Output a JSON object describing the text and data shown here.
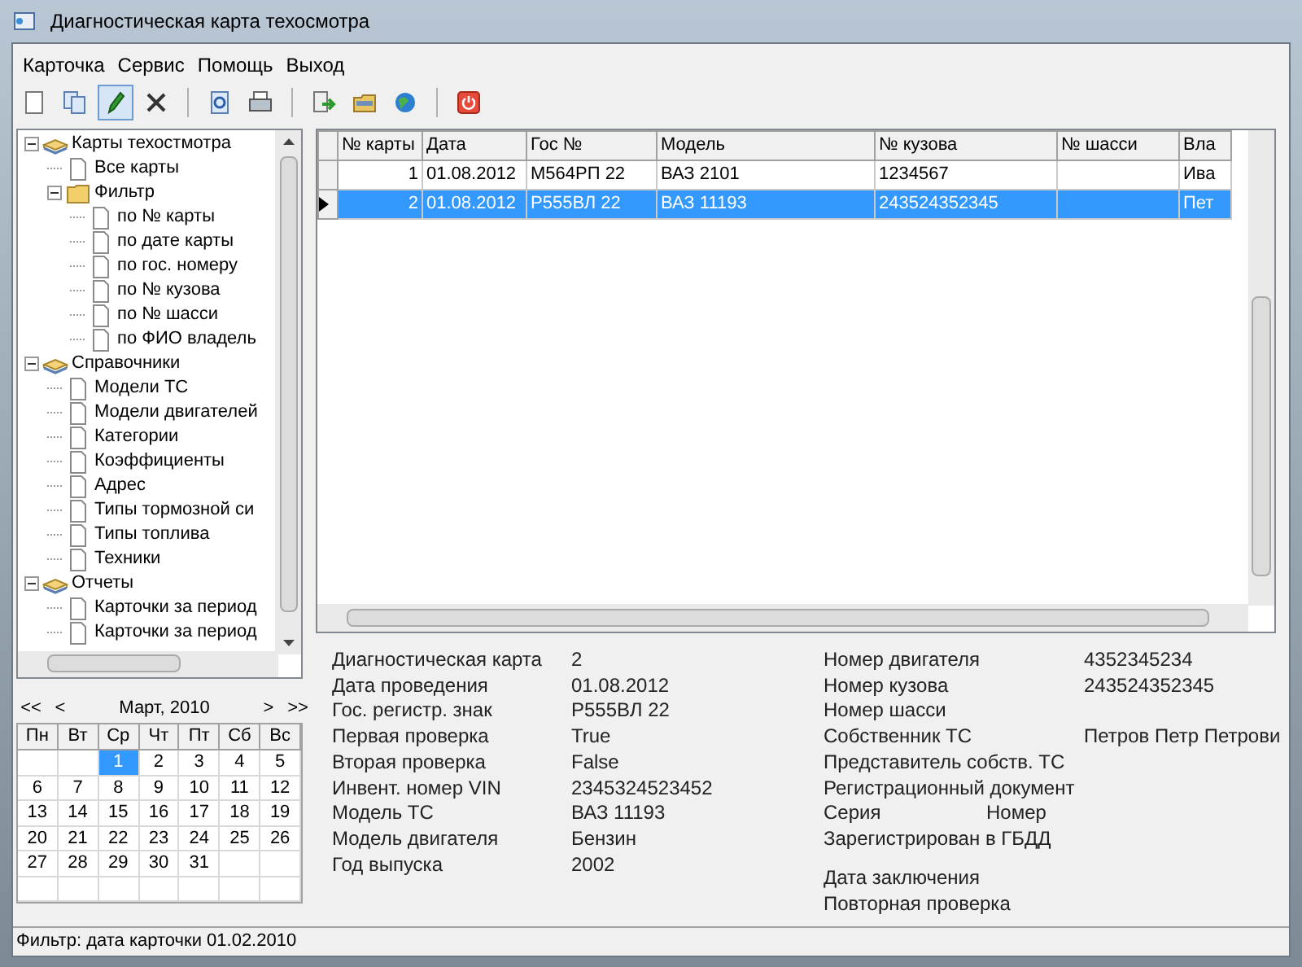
{
  "window": {
    "title": "Диагностическая карта техосмотра"
  },
  "menu": [
    "Карточка",
    "Сервис",
    "Помощь",
    "Выход"
  ],
  "toolbar": [
    {
      "kind": "new",
      "pressed": false
    },
    {
      "kind": "copy",
      "pressed": false
    },
    {
      "kind": "edit",
      "pressed": true
    },
    {
      "kind": "delete",
      "pressed": false
    },
    {
      "kind": "sep"
    },
    {
      "kind": "preview",
      "pressed": false
    },
    {
      "kind": "print",
      "pressed": false
    },
    {
      "kind": "sep"
    },
    {
      "kind": "export",
      "pressed": false
    },
    {
      "kind": "folder",
      "pressed": false
    },
    {
      "kind": "globe",
      "pressed": false
    },
    {
      "kind": "sep"
    },
    {
      "kind": "power",
      "pressed": false
    }
  ],
  "tree": [
    {
      "label": "Карты техостмотра",
      "kind": "books",
      "expanded": true,
      "children": [
        {
          "label": "Все карты",
          "kind": "doc"
        },
        {
          "label": "Фильтр",
          "kind": "folder",
          "expanded": true,
          "children": [
            {
              "label": "по № карты",
              "kind": "doc"
            },
            {
              "label": "по дате карты",
              "kind": "doc"
            },
            {
              "label": "по гос. номеру",
              "kind": "doc"
            },
            {
              "label": "по № кузова",
              "kind": "doc"
            },
            {
              "label": "по № шасси",
              "kind": "doc"
            },
            {
              "label": "по ФИО владель",
              "kind": "doc"
            }
          ]
        }
      ]
    },
    {
      "label": "Справочники",
      "kind": "books",
      "expanded": true,
      "children": [
        {
          "label": "Модели ТС",
          "kind": "doc"
        },
        {
          "label": "Модели двигателей",
          "kind": "doc"
        },
        {
          "label": "Категории",
          "kind": "doc"
        },
        {
          "label": "Коэффициенты",
          "kind": "doc"
        },
        {
          "label": "Адрес",
          "kind": "doc"
        },
        {
          "label": "Типы тормозной си",
          "kind": "doc"
        },
        {
          "label": "Типы топлива",
          "kind": "doc"
        },
        {
          "label": "Техники",
          "kind": "doc"
        }
      ]
    },
    {
      "label": "Отчеты",
      "kind": "books",
      "expanded": true,
      "children": [
        {
          "label": "Карточки за период",
          "kind": "doc"
        },
        {
          "label": "Карточки за период",
          "kind": "doc"
        }
      ]
    }
  ],
  "table": {
    "columns": [
      "№ карты",
      "Дата",
      "Гос №",
      "Модель",
      "№ кузова",
      "№ шасси",
      "Вла"
    ],
    "rows": [
      {
        "selected": false,
        "cells": [
          "1",
          "01.08.2012",
          "М564РП 22",
          "ВАЗ 2101",
          "1234567",
          "",
          "Ива"
        ]
      },
      {
        "selected": true,
        "cells": [
          "2",
          "01.08.2012",
          "Р555ВЛ 22",
          "ВАЗ 11193",
          "243524352345",
          "",
          "Пет"
        ]
      }
    ]
  },
  "details_left": [
    {
      "label": "Диагностическая карта",
      "value": "2"
    },
    {
      "label": "Дата проведения",
      "value": "01.08.2012"
    },
    {
      "label": "Гос. регистр. знак",
      "value": "Р555ВЛ 22"
    },
    {
      "label": "Первая проверка",
      "value": "True"
    },
    {
      "label": "Вторая проверка",
      "value": "False"
    },
    {
      "label": "Инвент. номер VIN",
      "value": "2345324523452"
    },
    {
      "label": "Модель ТС",
      "value": "ВАЗ 11193"
    },
    {
      "label": "Модель двигателя",
      "value": "Бензин"
    },
    {
      "label": "Год выпуска",
      "value": "2002"
    }
  ],
  "details_right": [
    {
      "label": "Номер двигателя",
      "value": "4352345234"
    },
    {
      "label": "Номер кузова",
      "value": "243524352345"
    },
    {
      "label": "Номер шасси"
    },
    {
      "label": "Собственник ТС",
      "value": "Петров Петр Петрови"
    },
    {
      "label": "Представитель собств. ТС"
    },
    {
      "label": "Регистрационный документ"
    },
    {
      "label": "Серия",
      "label_2": "Номер"
    },
    {
      "label": "Зарегистрирован в ГБДД"
    }
  ],
  "details_right_bottom": [
    {
      "label": "Дата заключения"
    },
    {
      "label": "Повторная проверка"
    }
  ],
  "calendar": {
    "title": "Март, 2010",
    "nav": [
      "<<",
      "<",
      ">",
      ">>"
    ],
    "weekdays": [
      "Пн",
      "Вт",
      "Ср",
      "Чт",
      "Пт",
      "Сб",
      "Вс"
    ],
    "weeks": [
      [
        {
          "label": "1",
          "selected": true
        },
        {
          "label": "2",
          "selected": false
        },
        {
          "label": "3",
          "selected": false
        },
        {
          "label": "4",
          "selected": false
        },
        {
          "label": "5",
          "selected": false
        }
      ],
      [
        {
          "label": "6",
          "selected": false
        },
        {
          "label": "7",
          "selected": false
        },
        {
          "label": "8",
          "selected": false
        },
        {
          "label": "9",
          "selected": false
        },
        {
          "label": "10",
          "selected": false
        },
        {
          "label": "11",
          "selected": false
        },
        {
          "label": "12",
          "selected": false
        }
      ],
      [
        {
          "label": "13",
          "selected": false
        },
        {
          "label": "14",
          "selected": false
        },
        {
          "label": "15",
          "selected": false
        },
        {
          "label": "16",
          "selected": false
        },
        {
          "label": "17",
          "selected": false
        },
        {
          "label": "18",
          "selected": false
        },
        {
          "label": "19",
          "selected": false
        }
      ],
      [
        {
          "label": "20",
          "selected": false
        },
        {
          "label": "21",
          "selected": false
        },
        {
          "label": "22",
          "selected": false
        },
        {
          "label": "23",
          "selected": false
        },
        {
          "label": "24",
          "selected": false
        },
        {
          "label": "25",
          "selected": false
        },
        {
          "label": "26",
          "selected": false
        }
      ],
      [
        {
          "label": "27",
          "selected": false
        },
        {
          "label": "28",
          "selected": false
        },
        {
          "label": "29",
          "selected": false
        },
        {
          "label": "30",
          "selected": false
        },
        {
          "label": "31",
          "selected": false
        }
      ]
    ]
  },
  "status_bar": "Фильтр: дата карточки 01.02.2010"
}
